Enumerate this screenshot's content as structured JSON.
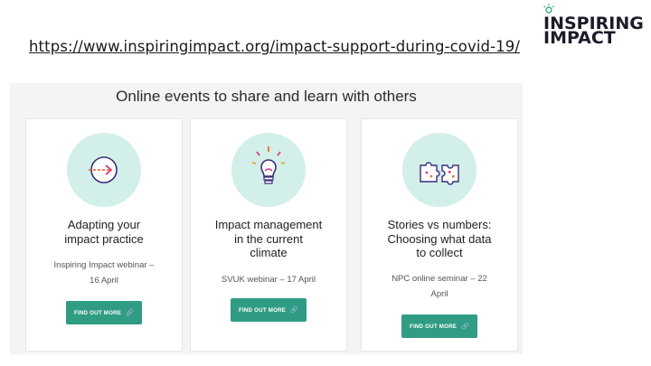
{
  "link": {
    "url": "https://www.inspiringimpact.org/impact-support-during-covid-19/"
  },
  "logo": {
    "line1": "INSPIRING",
    "line2": "IMPACT"
  },
  "panel": {
    "title": "Online events to share and learn with others"
  },
  "cards": [
    {
      "title_lines": [
        "Adapting your",
        "impact practice"
      ],
      "sub_lines": [
        "Inspiring Impact webinar –",
        "16 April"
      ],
      "button": "FIND OUT MORE",
      "icon": "arrow-icon"
    },
    {
      "title_lines": [
        "Impact management",
        "in the current",
        "climate"
      ],
      "sub_lines": [
        "SVUK webinar – 17 April"
      ],
      "button": "FIND OUT MORE",
      "icon": "lightbulb-icon"
    },
    {
      "title_lines": [
        "Stories vs numbers:",
        "Choosing what data",
        "to collect"
      ],
      "sub_lines": [
        "NPC online seminar – 22",
        "April"
      ],
      "button": "FIND OUT MORE",
      "icon": "puzzle-icon"
    }
  ],
  "colors": {
    "accent": "#2f9c83",
    "icon_bg": "#d2efe9",
    "panel_bg": "#f3f4f4"
  }
}
